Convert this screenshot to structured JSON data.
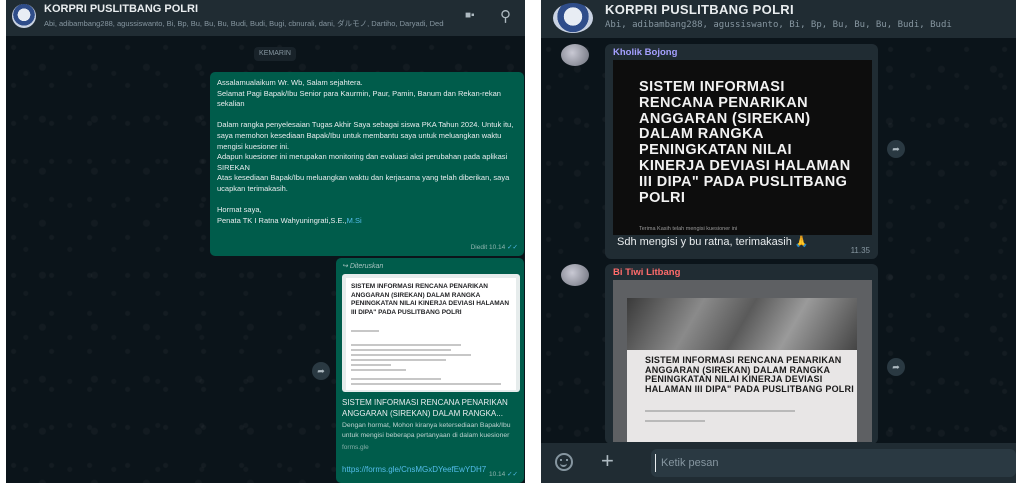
{
  "left": {
    "header": {
      "title": "KORPRI  PUSLITBANG POLRI",
      "members": "Abi, adibambang288, agussiswanto, Bi, Bp, Bu, Bu, Bu, Budi, Budi, Bugi, cbnurali, dani, ダルモノ, Dartiho, Daryadi, Dedi, Dc...",
      "icons": [
        "video-call-icon",
        "search-icon"
      ]
    },
    "day_chip": "KEMARIN",
    "message1": {
      "p1a": "Assalamualaikum Wr. Wb, Salam sejahtera.",
      "p1b": "Selamat Pagi Bapak/Ibu Senior para Kaurmin, Paur, Pamin, Banum dan Rekan-rekan sekalian",
      "p2": "Dalam rangka penyelesaian Tugas Akhir Saya sebagai siswa PKA Tahun 2024. Untuk itu, saya memohon kesediaan Bapak/Ibu untuk membantu saya untuk meluangkan waktu mengisi kuesioner ini.",
      "p3": "Adapun kuesioner ini merupakan monitoring dan evaluasi aksi perubahan pada aplikasi SIREKAN",
      "p4": "Atas kesediaan Bapak/Ibu meluangkan waktu dan kerjasama yang telah diberikan, saya ucapkan terimakasih.",
      "p5a": "Hormat saya,",
      "p5b": "Penata TK I Ratna Wahyuningrati,S.E.,",
      "p5link": "M.Si",
      "meta": "Diedit 10.14",
      "ticks": "✓✓"
    },
    "message2": {
      "forwarded": "Diteruskan",
      "preview_title": "SISTEM INFORMASI RENCANA PENARIKAN ANGGARAN (SIREKAN) DALAM RANGKA PENINGKATAN NILAI KINERJA DEVIASI HALAMAN III DIPA\" PADA PUSLITBANG POLRI",
      "link_title": "SISTEM INFORMASI RENCANA PENARIKAN ANGGARAN (SIREKAN) DALAM RANGKA...",
      "link_desc": "Dengan hormat, Mohon kiranya ketersediaan Bapak/Ibu untuk mengisi beberapa pertanyaan di dalam kuesioner",
      "link_domain": "forms.gle",
      "url": "https://forms.gle/CnsMGxDYeefEwYDH7",
      "meta": "10.14",
      "ticks": "✓✓"
    }
  },
  "right": {
    "header": {
      "title": "KORPRI  PUSLITBANG POLRI",
      "members": "Abi, adibambang288, agussiswanto, Bi, Bp, Bu, Bu, Bu, Budi, Budi"
    },
    "message1": {
      "sender": "Kholik Bojong",
      "image_text": "SISTEM INFORMASI RENCANA PENARIKAN ANGGARAN (SIREKAN) DALAM RANGKA PENINGKATAN NILAI KINERJA DEVIASI HALAMAN III DIPA\" PADA PUSLITBANG POLRI",
      "image_small": "Terima Kasih telah mengisi kuesioner ini",
      "caption": "Sdh mengisi y bu ratna, terimakasih 🙏",
      "time": "11.35"
    },
    "message2": {
      "sender": "Bi Tiwi Litbang",
      "photo_text": "SISTEM INFORMASI RENCANA PENARIKAN ANGGARAN (SIREKAN) DALAM RANGKA PENINGKATAN NILAI KINERJA DEVIASI HALAMAN III DIPA\" PADA PUSLITBANG POLRI"
    },
    "composer": {
      "placeholder": "Ketik pesan",
      "icons": [
        "emoji-icon",
        "attach-plus-icon"
      ]
    }
  },
  "colors": {
    "outgoing_bubble": "#005c4b",
    "incoming_bubble": "#202c33",
    "header": "#202c33",
    "link": "#53bdeb"
  }
}
